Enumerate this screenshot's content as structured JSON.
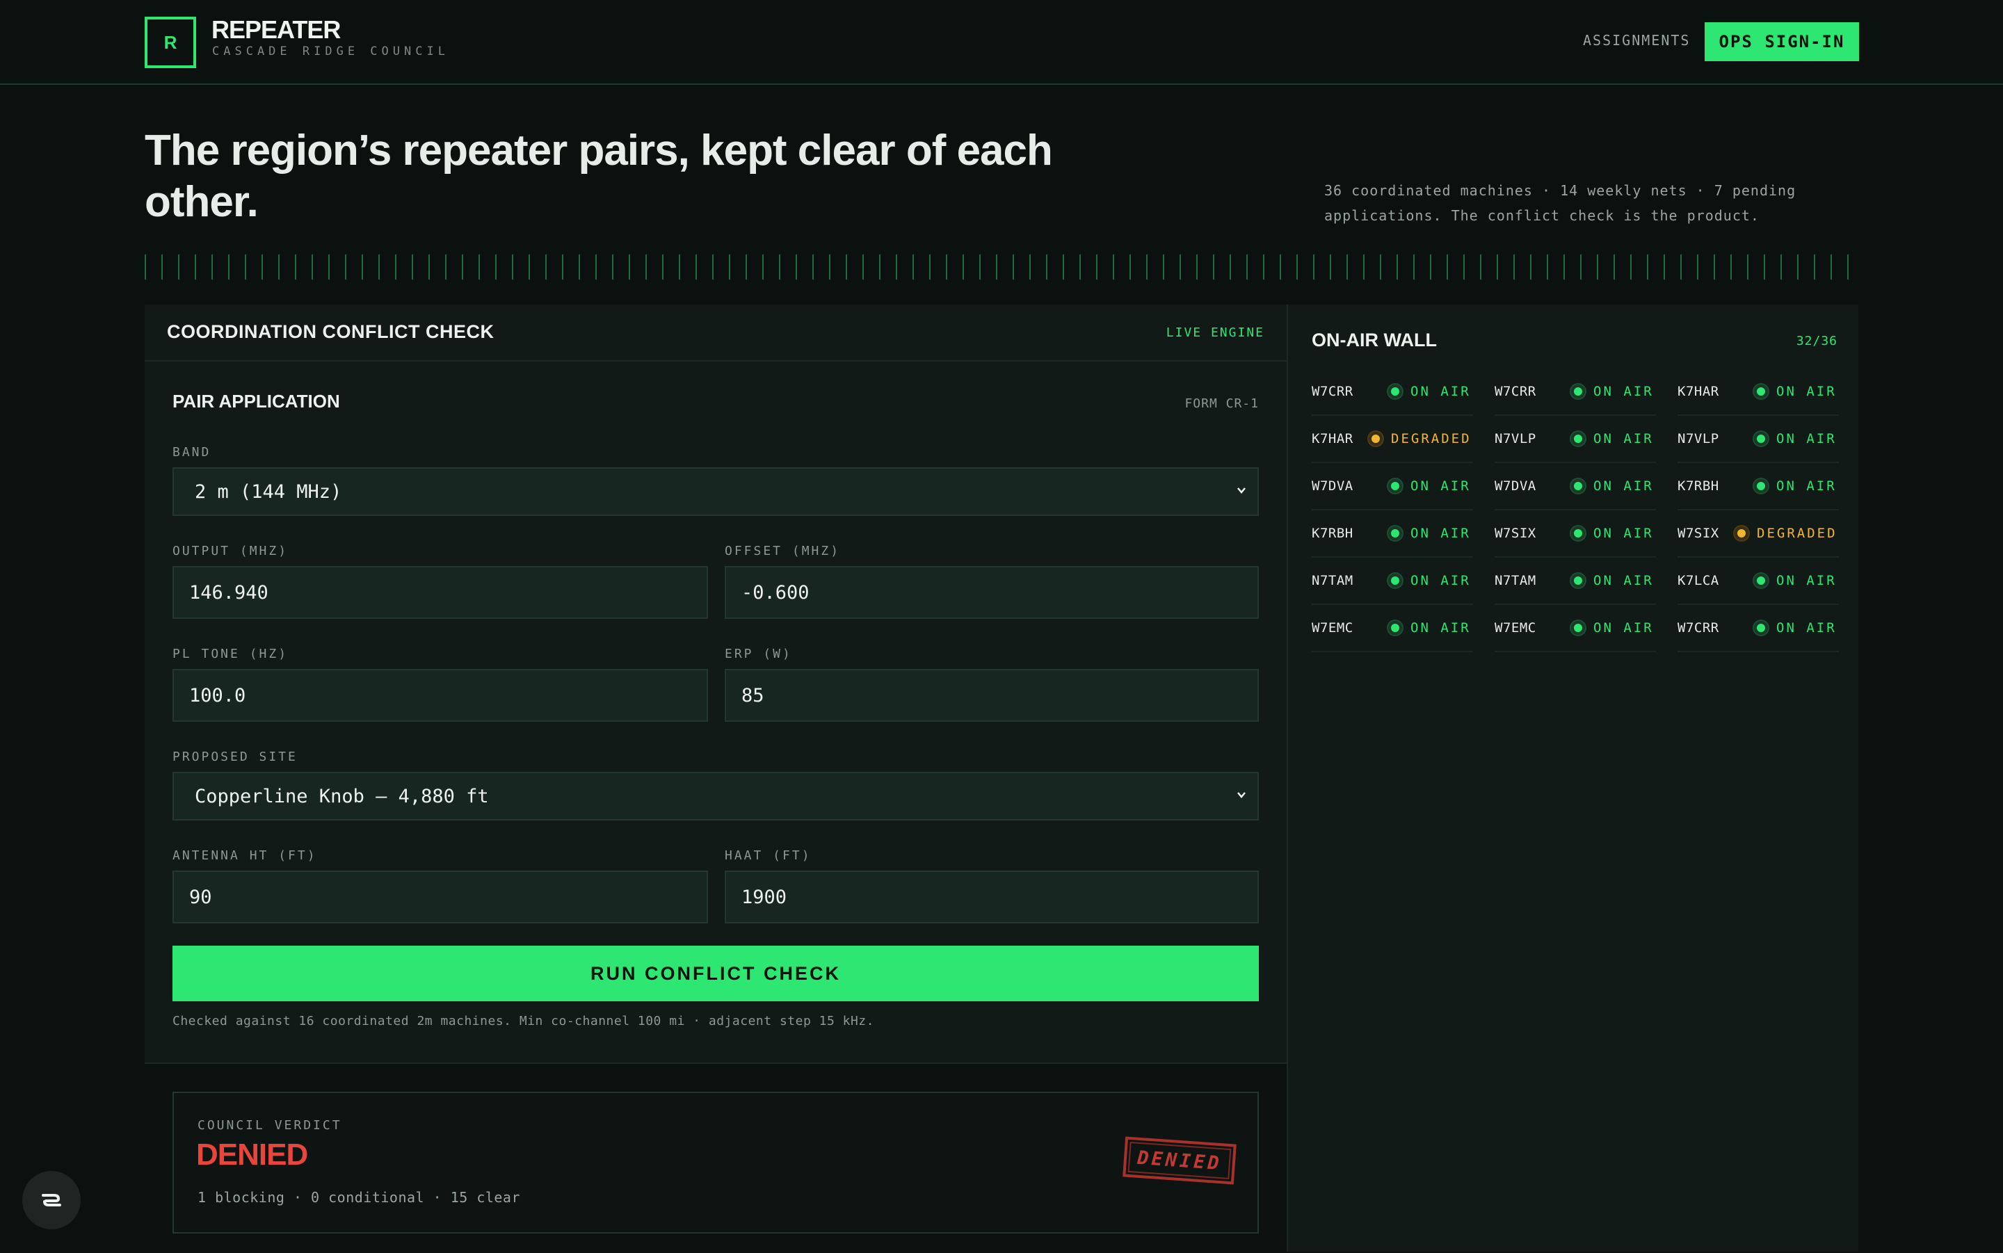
{
  "header": {
    "logo_letter": "R",
    "brand": "REPEATER",
    "brand_sub": "CASCADE RIDGE COUNCIL",
    "nav_assignments": "ASSIGNMENTS",
    "ops_signin": "OPS SIGN-IN"
  },
  "hero": {
    "title": "The region’s repeater pairs, kept clear of each other.",
    "meta": "36 coordinated machines · 14 weekly nets · 7 pending applications. The conflict check is the product."
  },
  "conflict_check": {
    "title": "COORDINATION CONFLICT CHECK",
    "badge": "LIVE ENGINE",
    "form": {
      "title": "PAIR APPLICATION",
      "form_id": "FORM CR-1",
      "band_label": "BAND",
      "band_value": "2 m (144 MHz)",
      "output_label": "OUTPUT (MHZ)",
      "output_value": "146.940",
      "offset_label": "OFFSET (MHZ)",
      "offset_value": "-0.600",
      "pl_label": "PL TONE (HZ)",
      "pl_value": "100.0",
      "erp_label": "ERP (W)",
      "erp_value": "85",
      "site_label": "PROPOSED SITE",
      "site_value": "Copperline Knob — 4,880 ft",
      "antenna_label": "ANTENNA HT (FT)",
      "antenna_value": "90",
      "haat_label": "HAAT (FT)",
      "haat_value": "1900",
      "run_button": "RUN CONFLICT CHECK",
      "note": "Checked against 16 coordinated 2m machines. Min co-channel 100 mi · adjacent step 15 kHz."
    },
    "verdict": {
      "label": "COUNCIL VERDICT",
      "value": "DENIED",
      "counts": "1 blocking · 0 conditional · 15 clear",
      "stamp": "DENIED"
    }
  },
  "on_air": {
    "title": "ON-AIR WALL",
    "count": "32/36",
    "colors": {
      "on_air": "#2ee672",
      "degraded": "#f2b632"
    },
    "items": [
      {
        "call": "W7CRR",
        "status": "ON AIR"
      },
      {
        "call": "W7CRR",
        "status": "ON AIR"
      },
      {
        "call": "K7HAR",
        "status": "ON AIR"
      },
      {
        "call": "K7HAR",
        "status": "DEGRADED"
      },
      {
        "call": "N7VLP",
        "status": "ON AIR"
      },
      {
        "call": "N7VLP",
        "status": "ON AIR"
      },
      {
        "call": "W7DVA",
        "status": "ON AIR"
      },
      {
        "call": "W7DVA",
        "status": "ON AIR"
      },
      {
        "call": "K7RBH",
        "status": "ON AIR"
      },
      {
        "call": "K7RBH",
        "status": "ON AIR"
      },
      {
        "call": "W7SIX",
        "status": "ON AIR"
      },
      {
        "call": "W7SIX",
        "status": "DEGRADED"
      },
      {
        "call": "N7TAM",
        "status": "ON AIR"
      },
      {
        "call": "N7TAM",
        "status": "ON AIR"
      },
      {
        "call": "K7LCA",
        "status": "ON AIR"
      },
      {
        "call": "W7EMC",
        "status": "ON AIR"
      },
      {
        "call": "W7EMC",
        "status": "ON AIR"
      },
      {
        "call": "W7CRR",
        "status": "ON AIR"
      }
    ]
  }
}
